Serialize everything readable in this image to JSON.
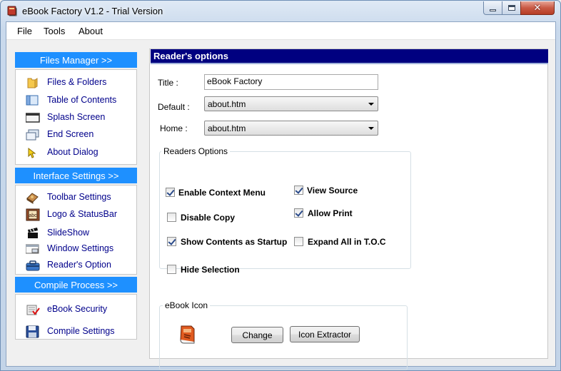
{
  "window": {
    "title": "eBook Factory  V1.2 - Trial Version"
  },
  "menu": [
    "File",
    "Tools",
    "About"
  ],
  "sidebar": {
    "groups": [
      {
        "header": "Files Manager >>",
        "items": [
          {
            "label": "Files & Folders",
            "icon": "folder-icon"
          },
          {
            "label": "Table of Contents",
            "icon": "toc-icon"
          },
          {
            "label": "Splash Screen",
            "icon": "splash-screen-icon"
          },
          {
            "label": "End Screen",
            "icon": "end-screen-icon"
          },
          {
            "label": "About Dialog",
            "icon": "about-dialog-icon"
          }
        ]
      },
      {
        "header": "Interface Settings >>",
        "items": [
          {
            "label": "Toolbar Settings",
            "icon": "toolbar-icon"
          },
          {
            "label": "Logo & StatusBar",
            "icon": "logo-icon"
          },
          {
            "label": "SlideShow",
            "icon": "slideshow-icon"
          },
          {
            "label": "Window Settings",
            "icon": "window-icon"
          },
          {
            "label": "Reader's Option",
            "icon": "reader-option-icon"
          }
        ]
      },
      {
        "header": "Compile Process >>",
        "items": [
          {
            "label": "eBook Security",
            "icon": "security-icon"
          },
          {
            "label": "Compile Settings",
            "icon": "save-disk-icon"
          }
        ]
      }
    ]
  },
  "panel": {
    "header": "Reader's options",
    "title_label": "Title :",
    "title_value": "eBook Factory",
    "default_label": "Default :",
    "default_value": "about.htm",
    "home_label": "Home :",
    "home_value": "about.htm",
    "readers_options": {
      "legend": "Readers Options",
      "checkboxes": [
        {
          "label": "Enable Context Menu",
          "checked": true
        },
        {
          "label": "View Source",
          "checked": true
        },
        {
          "label": "Disable Copy",
          "checked": false
        },
        {
          "label": "Allow Print",
          "checked": true
        },
        {
          "label": "Show Contents as Startup",
          "checked": true
        },
        {
          "label": "Expand All in T.O.C",
          "checked": false
        },
        {
          "label": "Hide Selection",
          "checked": false
        }
      ]
    },
    "ebook_icon": {
      "legend": "eBook Icon",
      "change_label": "Change",
      "extract_label": "Icon Extractor"
    }
  },
  "colors": {
    "header_blue": "#1e90ff",
    "panel_header": "#000080",
    "link": "#00008b"
  }
}
